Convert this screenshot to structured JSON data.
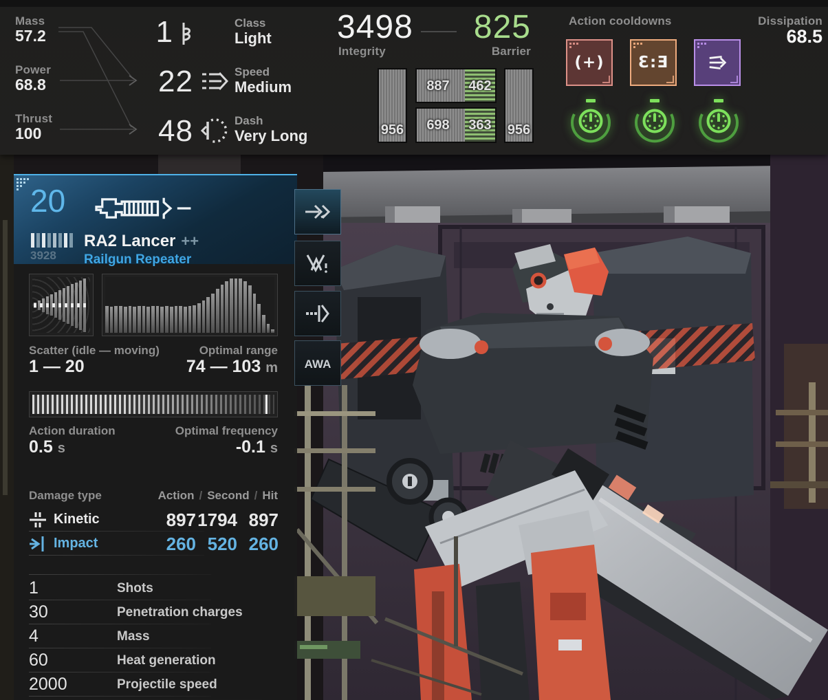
{
  "top_bar": {
    "mobility": {
      "inputs": [
        {
          "label": "Mass",
          "value": "57.2"
        },
        {
          "label": "Power",
          "value": "68.8"
        },
        {
          "label": "Thrust",
          "value": "100"
        }
      ],
      "outputs": [
        {
          "value": "1",
          "label": "Class",
          "rating": "Light",
          "icon": "class-icon"
        },
        {
          "value": "22",
          "label": "Speed",
          "rating": "Medium",
          "icon": "speed-icon"
        },
        {
          "value": "48",
          "label": "Dash",
          "rating": "Very Long",
          "icon": "dash-icon"
        }
      ]
    },
    "integrity": {
      "value": "3498",
      "label": "Integrity"
    },
    "barrier": {
      "value": "825",
      "label": "Barrier",
      "color": "#a8dc8c"
    },
    "body_parts": {
      "left_arm": "956",
      "right_arm": "956",
      "torso_structure": "887",
      "torso_barrier": "462",
      "core_structure": "698",
      "core_barrier": "363"
    },
    "cooldowns": {
      "label": "Action cooldowns",
      "slots": [
        {
          "icon": "equipment-slot-1-icon",
          "glyph": "(+)",
          "bg": "#5d3634",
          "border": "#dd9188",
          "status_icon": "cooldown-ready-dial-icon"
        },
        {
          "icon": "equipment-slot-2-icon",
          "glyph": "Ɛ:Ǝ",
          "bg": "#63452f",
          "border": "#eeab7e",
          "status_icon": "cooldown-ready-dial-icon"
        },
        {
          "icon": "equipment-slot-3-icon",
          "glyph": "",
          "bg": "#58407a",
          "border": "#b98fe8",
          "status_icon": "cooldown-ready-dial-icon"
        }
      ],
      "dial_color": "#7de05c"
    },
    "dissipation": {
      "label": "Dissipation",
      "value": "68.5"
    }
  },
  "weapon_panel": {
    "slot_number": "20",
    "ammo": "3928",
    "name": "RA2 Lancer",
    "upgrade_marks": "++",
    "type": "Railgun Repeater",
    "accent_color": "#3fa6e4",
    "scatter": {
      "label": "Scatter (idle — moving)",
      "value": "1 — 20"
    },
    "optimal_range": {
      "label": "Optimal range",
      "value": "74 — 103",
      "unit": "m"
    },
    "action_duration": {
      "label": "Action duration",
      "value": "0.5",
      "unit": "s"
    },
    "optimal_frequency": {
      "label": "Optimal frequency",
      "value": "-0.1",
      "unit": "s"
    },
    "range_profile": {
      "bars": [
        48,
        47,
        48,
        48,
        47,
        48,
        47,
        48,
        48,
        47,
        48,
        48,
        47,
        48,
        47,
        48,
        48,
        47,
        48,
        50,
        53,
        58,
        64,
        71,
        79,
        86,
        93,
        97,
        98,
        97,
        93,
        85,
        70,
        52,
        32,
        16,
        6
      ]
    },
    "scatter_cone": {
      "bar_count": 13
    },
    "damage": {
      "header_label": "Damage type",
      "columns": [
        "Action",
        "Second",
        "Hit"
      ],
      "rows": [
        {
          "type": "Kinetic",
          "values": [
            "897",
            "1794",
            "897"
          ],
          "color": "#e8e8e8",
          "icon": "kinetic-damage-icon"
        },
        {
          "type": "Impact",
          "values": [
            "260",
            "520",
            "260"
          ],
          "color": "#64b3e2",
          "icon": "impact-damage-icon"
        }
      ]
    },
    "stats": [
      {
        "value": "1",
        "label": "Shots"
      },
      {
        "value": "30",
        "label": "Penetration charges"
      },
      {
        "value": "4",
        "label": "Mass"
      },
      {
        "value": "60",
        "label": "Heat generation"
      },
      {
        "value": "2000",
        "label": "Projectile speed"
      }
    ]
  },
  "side_buttons": [
    {
      "name": "fire-action-button",
      "icon": "arrow-right-icon",
      "active": true
    },
    {
      "name": "overwatch-action-button",
      "icon": "double-vee-alert-icon",
      "active": false
    },
    {
      "name": "dash-fire-action-button",
      "icon": "dashed-arrow-bar-icon",
      "active": false
    },
    {
      "name": "melee-action-button",
      "icon": "awa-glyph-icon",
      "active": false
    }
  ]
}
